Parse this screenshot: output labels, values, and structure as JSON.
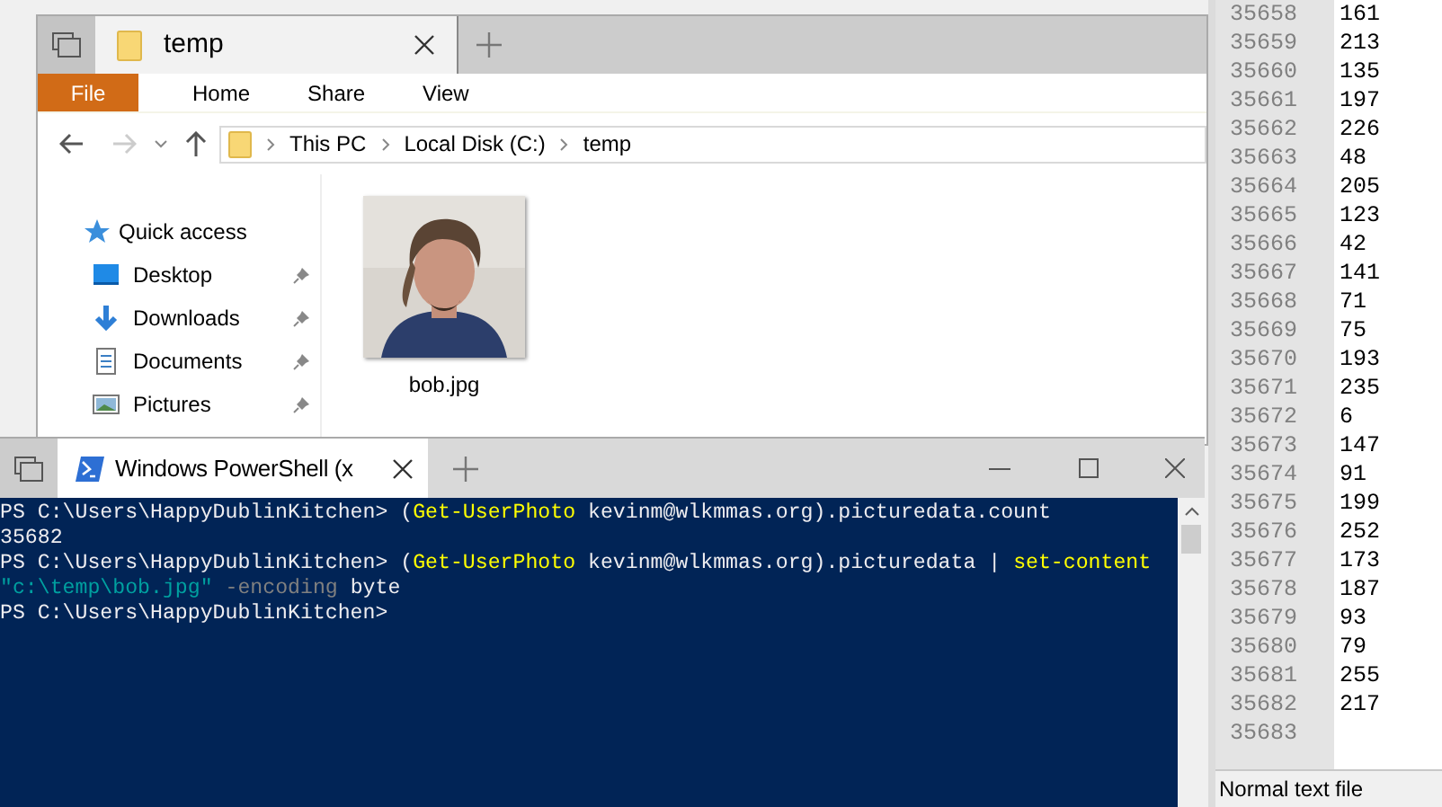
{
  "explorer": {
    "tab_title": "temp",
    "ribbon_tabs": [
      {
        "label": "File",
        "selected": true
      },
      {
        "label": "Home",
        "selected": false
      },
      {
        "label": "Share",
        "selected": false
      },
      {
        "label": "View",
        "selected": false
      }
    ],
    "breadcrumb": [
      "This PC",
      "Local Disk (C:)",
      "temp"
    ],
    "sidebar": [
      {
        "label": "Quick access",
        "kind": "star",
        "pinned": false
      },
      {
        "label": "Desktop",
        "kind": "desktop",
        "pinned": true
      },
      {
        "label": "Downloads",
        "kind": "download",
        "pinned": true
      },
      {
        "label": "Documents",
        "kind": "document",
        "pinned": true
      },
      {
        "label": "Pictures",
        "kind": "pictures",
        "pinned": true
      }
    ],
    "files": [
      {
        "name": "bob.jpg",
        "kind": "picture"
      }
    ]
  },
  "powershell": {
    "tab_title": "Windows PowerShell (x",
    "lines": [
      [
        {
          "kind": "plain",
          "text": "PS C:\\Users\\HappyDublinKitchen> ("
        },
        {
          "kind": "command",
          "text": "Get-UserPhoto"
        },
        {
          "kind": "plain",
          "text": " kevinm@wlkmmas.org).picturedata.count"
        }
      ],
      [
        {
          "kind": "plain",
          "text": "35682"
        }
      ],
      [
        {
          "kind": "plain",
          "text": "PS C:\\Users\\HappyDublinKitchen> ("
        },
        {
          "kind": "command",
          "text": "Get-UserPhoto"
        },
        {
          "kind": "plain",
          "text": " kevinm@wlkmmas.org).picturedata | "
        },
        {
          "kind": "command",
          "text": "set-content"
        }
      ],
      [
        {
          "kind": "string",
          "text": "\"c:\\temp\\bob.jpg\""
        },
        {
          "kind": "param",
          "text": " -encoding"
        },
        {
          "kind": "plain",
          "text": " byte"
        }
      ],
      [
        {
          "kind": "plain",
          "text": "PS C:\\Users\\HappyDublinKitchen>"
        }
      ]
    ]
  },
  "editor": {
    "lines": [
      {
        "number": "35658",
        "value": "161"
      },
      {
        "number": "35659",
        "value": "213"
      },
      {
        "number": "35660",
        "value": "135"
      },
      {
        "number": "35661",
        "value": "197"
      },
      {
        "number": "35662",
        "value": "226"
      },
      {
        "number": "35663",
        "value": "48"
      },
      {
        "number": "35664",
        "value": "205"
      },
      {
        "number": "35665",
        "value": "123"
      },
      {
        "number": "35666",
        "value": "42"
      },
      {
        "number": "35667",
        "value": "141"
      },
      {
        "number": "35668",
        "value": "71"
      },
      {
        "number": "35669",
        "value": "75"
      },
      {
        "number": "35670",
        "value": "193"
      },
      {
        "number": "35671",
        "value": "235"
      },
      {
        "number": "35672",
        "value": "6"
      },
      {
        "number": "35673",
        "value": "147"
      },
      {
        "number": "35674",
        "value": "91"
      },
      {
        "number": "35675",
        "value": "199"
      },
      {
        "number": "35676",
        "value": "252"
      },
      {
        "number": "35677",
        "value": "173"
      },
      {
        "number": "35678",
        "value": "187"
      },
      {
        "number": "35679",
        "value": "93"
      },
      {
        "number": "35680",
        "value": "79"
      },
      {
        "number": "35681",
        "value": "255"
      },
      {
        "number": "35682",
        "value": "217"
      },
      {
        "number": "35683"
      }
    ],
    "status": "Normal text file"
  }
}
